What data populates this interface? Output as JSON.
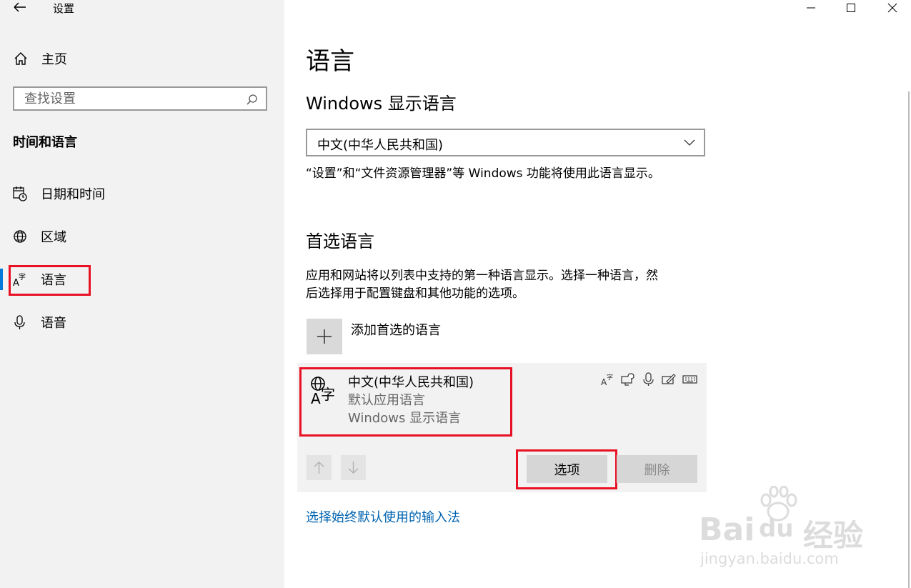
{
  "window": {
    "title": "设置",
    "controls": {
      "minimize": "minimize",
      "maximize": "maximize",
      "close": "close"
    }
  },
  "sidebar": {
    "home_label": "主页",
    "search_placeholder": "查找设置",
    "section_title": "时间和语言",
    "items": [
      {
        "label": "日期和时间",
        "icon": "calendar-clock-icon"
      },
      {
        "label": "区域",
        "icon": "globe-icon"
      },
      {
        "label": "语言",
        "icon": "language-icon",
        "selected": true
      },
      {
        "label": "语音",
        "icon": "microphone-icon"
      }
    ]
  },
  "main": {
    "title": "语言",
    "display_language": {
      "heading": "Windows 显示语言",
      "selected": "中文(中华人民共和国)",
      "description": "“设置”和“文件资源管理器”等 Windows 功能将使用此语言显示。"
    },
    "preferred": {
      "heading": "首选语言",
      "description_line1": "应用和网站将以列表中支持的第一种语言显示。选择一种语言，然",
      "description_line2": "后选择用于配置键盘和其他功能的选项。",
      "add_label": "添加首选的语言",
      "languages": [
        {
          "name": "中文(中华人民共和国)",
          "sub1": "默认应用语言",
          "sub2": "Windows 显示语言",
          "features": [
            "language-pack-icon",
            "speech-icon",
            "microphone-icon",
            "handwriting-icon",
            "keyboard-icon"
          ]
        }
      ],
      "options_label": "选项",
      "remove_label": "删除"
    },
    "input_method_link": "选择始终默认使用的输入法"
  },
  "watermark": {
    "brand_latin": "Bai",
    "brand_du": "du",
    "brand_cn": "经验",
    "url": "jingyan.baidu.com"
  },
  "colors": {
    "accent": "#0078d7",
    "highlight": "#e81123",
    "link": "#0063b1",
    "sidebar_bg": "#f2f2f2"
  }
}
